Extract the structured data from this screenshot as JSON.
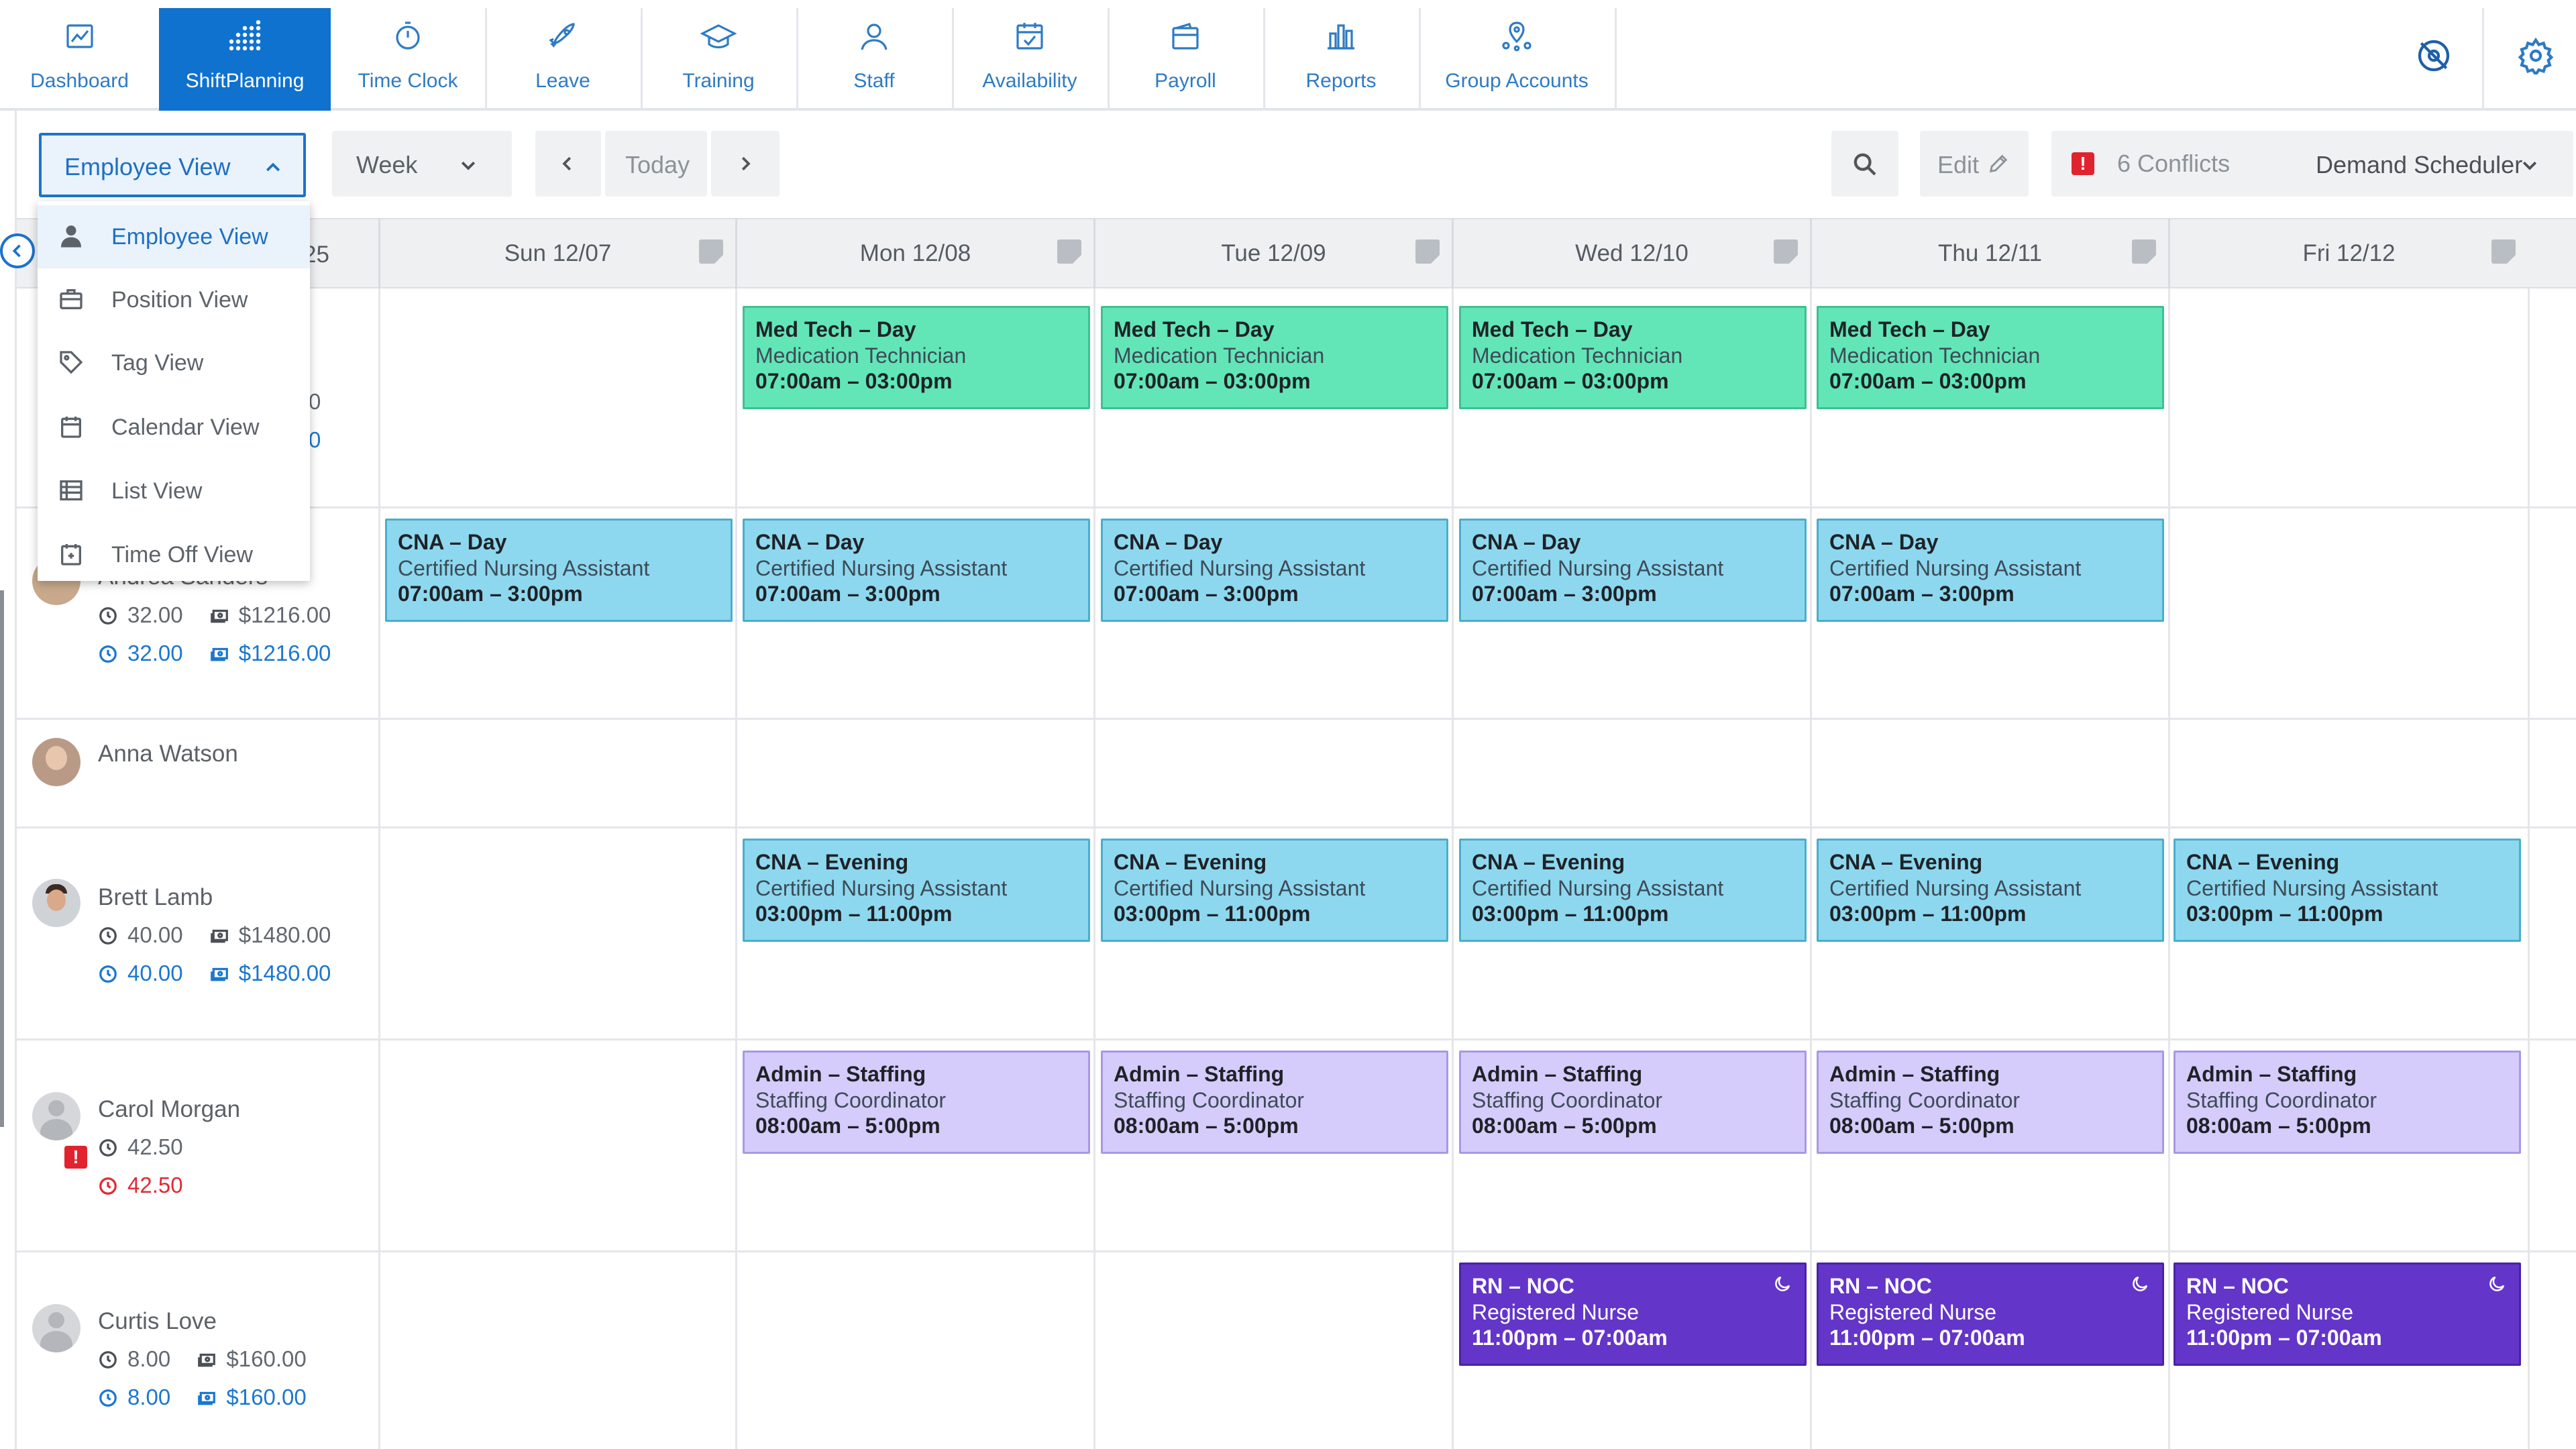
{
  "nav": {
    "items": [
      {
        "label": "Dashboard",
        "icon": "chart-line-icon"
      },
      {
        "label": "ShiftPlanning",
        "icon": "grid-dots-icon",
        "active": true
      },
      {
        "label": "Time Clock",
        "icon": "stopwatch-icon"
      },
      {
        "label": "Leave",
        "icon": "rocket-icon"
      },
      {
        "label": "Training",
        "icon": "graduation-cap-icon"
      },
      {
        "label": "Staff",
        "icon": "user-icon"
      },
      {
        "label": "Availability",
        "icon": "calendar-check-icon"
      },
      {
        "label": "Payroll",
        "icon": "wallet-icon"
      },
      {
        "label": "Reports",
        "icon": "bar-chart-icon"
      },
      {
        "label": "Group Accounts",
        "icon": "location-pins-icon"
      }
    ]
  },
  "toolbar": {
    "view_select": "Employee View",
    "period_select": "Week",
    "today_label": "Today",
    "edit_label": "Edit",
    "conflicts_label": "6 Conflicts",
    "scheduler_label": "Demand Scheduler"
  },
  "view_menu": {
    "items": [
      {
        "label": "Employee View",
        "icon": "person-icon"
      },
      {
        "label": "Position View",
        "icon": "briefcase-icon"
      },
      {
        "label": "Tag View",
        "icon": "tag-icon"
      },
      {
        "label": "Calendar View",
        "icon": "calendar-icon"
      },
      {
        "label": "List View",
        "icon": "list-icon"
      },
      {
        "label": "Time Off View",
        "icon": "calendar-x-icon"
      }
    ]
  },
  "grid": {
    "first_header_fragment": "25",
    "days": [
      "Sun 12/07",
      "Mon 12/08",
      "Tue 12/09",
      "Wed 12/10",
      "Thu 12/11",
      "Fri 12/12"
    ],
    "row0_fragment_a": "0",
    "row0_fragment_b": "0"
  },
  "employees": [
    {
      "name": "Andrea Sanders",
      "hours": "32.00",
      "cost": "$1216.00",
      "sched_hours": "32.00",
      "sched_cost": "$1216.00"
    },
    {
      "name": "Anna Watson"
    },
    {
      "name": "Brett Lamb",
      "hours": "40.00",
      "cost": "$1480.00",
      "sched_hours": "40.00",
      "sched_cost": "$1480.00"
    },
    {
      "name": "Carol Morgan",
      "hours": "42.50",
      "sched_hours": "42.50",
      "alert": "!"
    },
    {
      "name": "Curtis Love",
      "hours": "8.00",
      "cost": "$160.00",
      "sched_hours": "8.00",
      "sched_cost": "$160.00"
    }
  ],
  "shift_types": {
    "medtech": {
      "title": "Med Tech – Day",
      "role": "Medication Technician",
      "time": "07:00am – 03:00pm",
      "color": "#62e6b8"
    },
    "cna_day": {
      "title": "CNA – Day",
      "role": "Certified Nursing Assistant",
      "time": "07:00am – 3:00pm",
      "color": "#8dd8ee"
    },
    "cna_eve": {
      "title": "CNA – Evening",
      "role": "Certified Nursing Assistant",
      "time": "03:00pm – 11:00pm",
      "color": "#8dd8ee"
    },
    "admin": {
      "title": "Admin – Staffing",
      "role": "Staffing Coordinator",
      "time": "08:00am – 5:00pm",
      "color": "#d6ccfc"
    },
    "rn_noc": {
      "title": "RN – NOC",
      "role": "Registered Nurse",
      "time": "11:00pm – 07:00am",
      "color": "#6435c9",
      "icon": "moon-icon"
    }
  },
  "shifts": [
    {
      "type": "medtech",
      "row": 0,
      "day": 1
    },
    {
      "type": "medtech",
      "row": 0,
      "day": 2
    },
    {
      "type": "medtech",
      "row": 0,
      "day": 3
    },
    {
      "type": "medtech",
      "row": 0,
      "day": 4
    },
    {
      "type": "cna_day",
      "row": 1,
      "day": 0
    },
    {
      "type": "cna_day",
      "row": 1,
      "day": 1
    },
    {
      "type": "cna_day",
      "row": 1,
      "day": 2
    },
    {
      "type": "cna_day",
      "row": 1,
      "day": 3
    },
    {
      "type": "cna_day",
      "row": 1,
      "day": 4
    },
    {
      "type": "cna_eve",
      "row": 3,
      "day": 1
    },
    {
      "type": "cna_eve",
      "row": 3,
      "day": 2
    },
    {
      "type": "cna_eve",
      "row": 3,
      "day": 3
    },
    {
      "type": "cna_eve",
      "row": 3,
      "day": 4
    },
    {
      "type": "cna_eve",
      "row": 3,
      "day": 5
    },
    {
      "type": "admin",
      "row": 4,
      "day": 1
    },
    {
      "type": "admin",
      "row": 4,
      "day": 2
    },
    {
      "type": "admin",
      "row": 4,
      "day": 3
    },
    {
      "type": "admin",
      "row": 4,
      "day": 4
    },
    {
      "type": "admin",
      "row": 4,
      "day": 5
    },
    {
      "type": "rn_noc",
      "row": 5,
      "day": 3
    },
    {
      "type": "rn_noc",
      "row": 5,
      "day": 4
    },
    {
      "type": "rn_noc",
      "row": 5,
      "day": 5
    }
  ],
  "colors": {
    "accent": "#1072cf",
    "conflict": "#e0232e"
  }
}
